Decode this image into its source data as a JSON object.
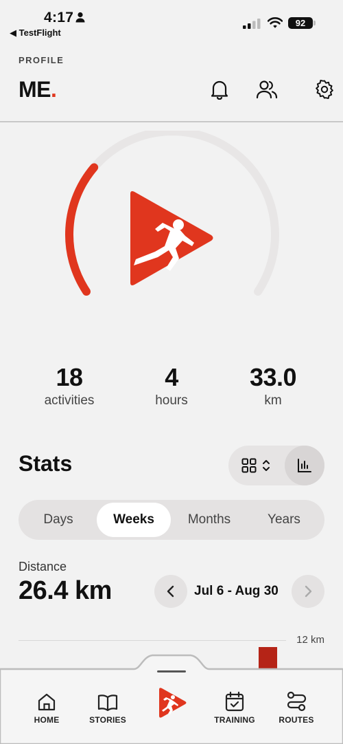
{
  "status_bar": {
    "time": "4:17",
    "back_app": "◀ TestFlight",
    "battery": "92"
  },
  "header": {
    "eyebrow": "PROFILE",
    "brand": "ME",
    "brand_dot": ".",
    "icons": [
      "bell-icon",
      "friends-icon",
      "gear-icon"
    ]
  },
  "gauge": {
    "progress": 0.3,
    "accent": "#e0361e",
    "track": "#e8e6e6"
  },
  "summary": [
    {
      "value": "18",
      "label": "activities"
    },
    {
      "value": "4",
      "label": "hours"
    },
    {
      "value": "33.0",
      "label": "km"
    }
  ],
  "stats": {
    "title": "Stats",
    "view_toggle": [
      "grid-icon",
      "bar-chart-icon"
    ],
    "segments": [
      "Days",
      "Weeks",
      "Months",
      "Years"
    ],
    "active_segment": "Weeks",
    "metric_label": "Distance",
    "metric_value": "26.4 km",
    "date_range": "Jul 6 - Aug 30",
    "chart_max_label": "12 km"
  },
  "tabbar": {
    "items": [
      {
        "label": "HOME",
        "icon": "home-icon"
      },
      {
        "label": "STORIES",
        "icon": "book-icon"
      },
      {
        "label": "TRAINING",
        "icon": "calendar-check-icon"
      },
      {
        "label": "ROUTES",
        "icon": "route-icon"
      }
    ],
    "center_icon": "run-play-icon"
  },
  "colors": {
    "accent": "#e0361e",
    "bar": "#b52417",
    "background": "#f2f2f2"
  }
}
